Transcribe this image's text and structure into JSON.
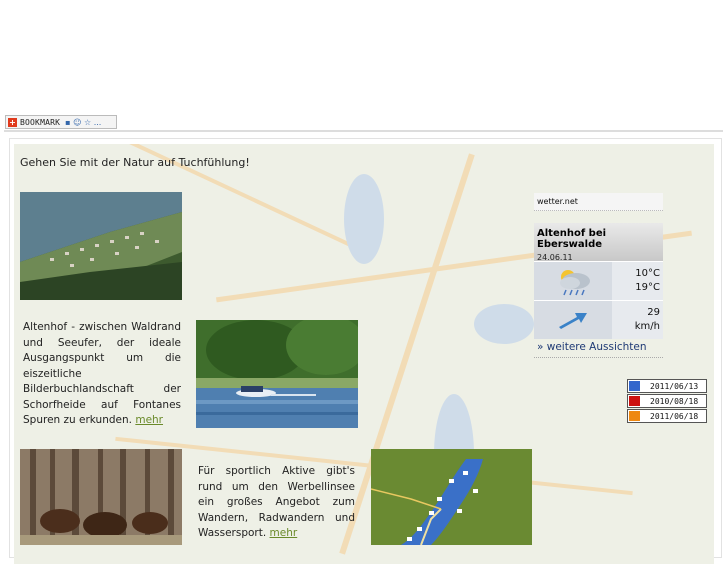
{
  "bookmark": {
    "label": "BOOKMARK",
    "icons_text": "▪ ☺ ☆ ..."
  },
  "intro": {
    "text": "Gehen Sie mit der Natur auf Tuchfühlung!"
  },
  "block1": {
    "text": "Altenhof - zwischen Waldrand und Seeufer, der ideale Ausgangspunkt um die eiszeitliche Bilderbuchlandschaft der Schorfheide auf Fontanes Spuren zu erkunden.",
    "link": "mehr"
  },
  "block2": {
    "text": "Für sportlich Aktive gibt's rund um den Werbellinsee ein großes Angebot zum Wandern, Radwandern und Wassersport.",
    "link": "mehr"
  },
  "weather": {
    "source": "wetter.net",
    "location": "Altenhof bei Eberswalde",
    "date": "24.06.11",
    "temp_low": "10°C",
    "temp_high": "19°C",
    "wind_speed": "29",
    "wind_unit": "km/h",
    "more_link": "» weitere Aussichten",
    "icons": {
      "condition": "cloud-sun-rain-icon",
      "wind": "wind-arrow-icon"
    }
  },
  "badges": [
    {
      "date": "2011/06/13",
      "icon": "google-icon",
      "color": "#3366cc"
    },
    {
      "date": "2010/08/18",
      "icon": "yahoo-icon",
      "color": "#cc1111"
    },
    {
      "date": "2011/06/18",
      "icon": "msn-icon",
      "color": "#ee8811"
    }
  ],
  "colors": {
    "link": "#6a8a2a",
    "weather_link": "#1f3a75",
    "bookmark_red": "#e03a1c"
  }
}
